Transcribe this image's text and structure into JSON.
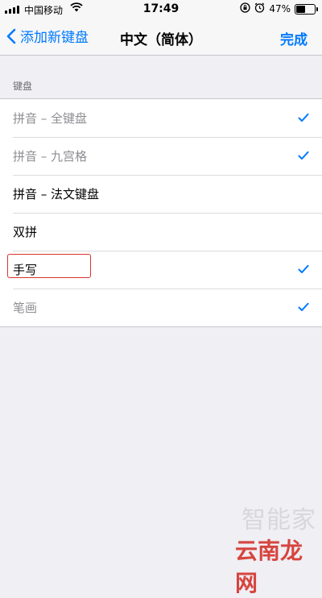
{
  "status_bar": {
    "carrier": "中国移动",
    "time": "17:49",
    "battery": "47%"
  },
  "nav": {
    "back_label": "添加新键盘",
    "title": "中文（简体）",
    "done_label": "完成"
  },
  "section": {
    "header": "键盘"
  },
  "keyboards": [
    {
      "label": "拼音 – 全键盘",
      "checked": true,
      "enabled": false
    },
    {
      "label": "拼音 – 九宫格",
      "checked": true,
      "enabled": false
    },
    {
      "label": "拼音 – 法文键盘",
      "checked": false,
      "enabled": true
    },
    {
      "label": "双拼",
      "checked": false,
      "enabled": true
    },
    {
      "label": "手写",
      "checked": true,
      "enabled": true
    },
    {
      "label": "笔画",
      "checked": true,
      "enabled": false
    }
  ],
  "colors": {
    "accent": "#007aff",
    "highlight": "#d9342b"
  },
  "watermark": {
    "line1": "智能家",
    "line2": "云南龙网"
  }
}
